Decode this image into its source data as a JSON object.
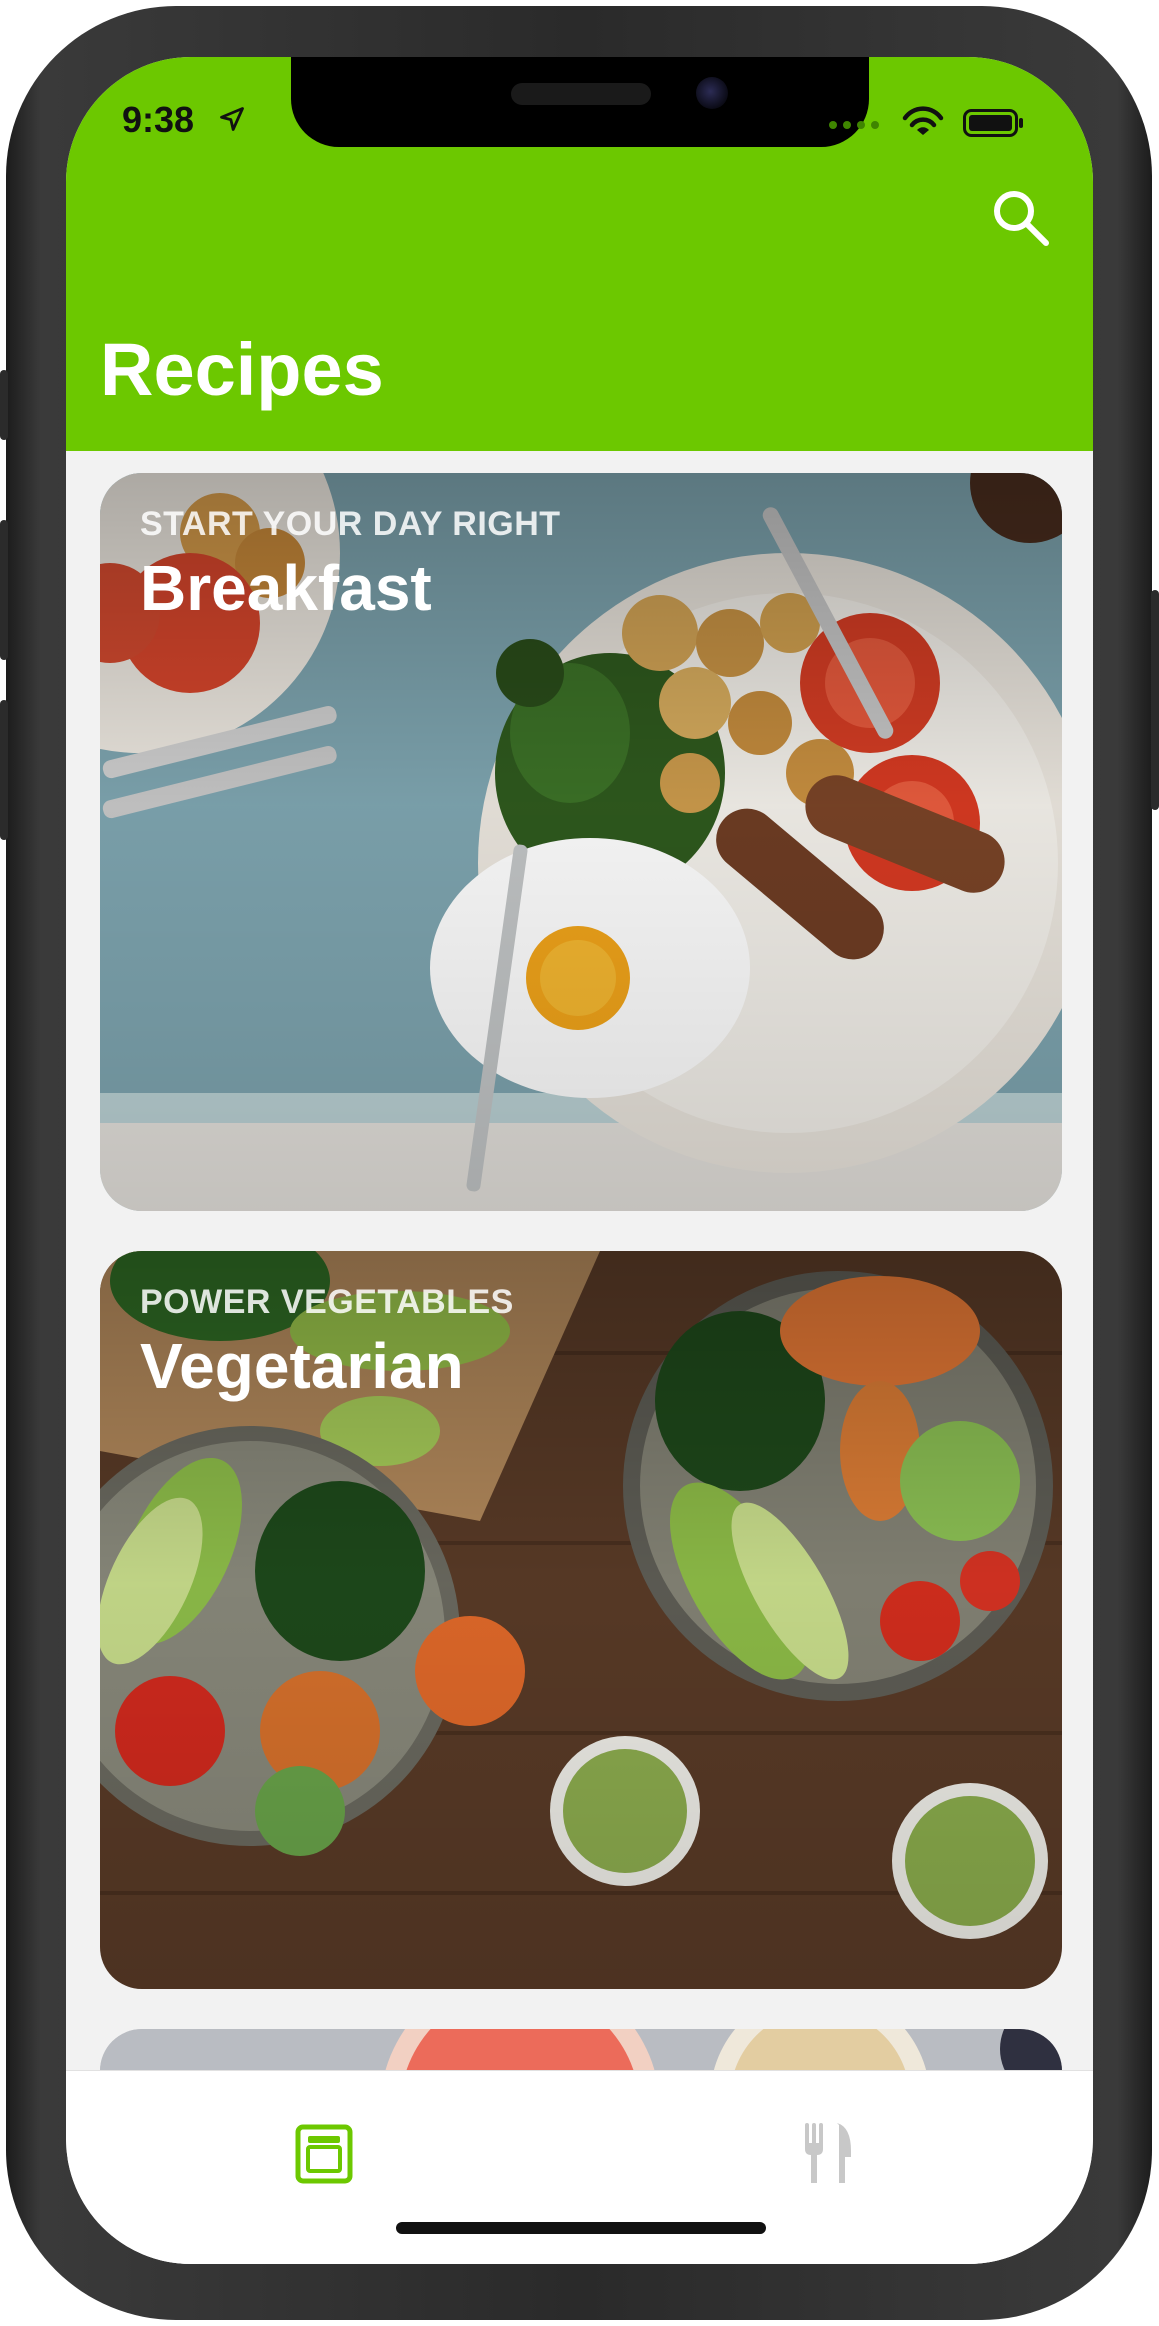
{
  "status_bar": {
    "time": "9:38"
  },
  "nav": {
    "title": "Recipes"
  },
  "icons": {
    "search": "search-icon",
    "location": "location-arrow-icon",
    "signal": "signal-dots-icon",
    "wifi": "wifi-icon",
    "battery": "battery-icon",
    "tab_recipes": "recipes-tab-icon",
    "tab_utensils": "fork-knife-icon"
  },
  "colors": {
    "accent": "#6cc800",
    "tab_active": "#6cc800",
    "tab_inactive": "#c8c8c8"
  },
  "categories": [
    {
      "subtitle": "START YOUR DAY RIGHT",
      "title": "Breakfast"
    },
    {
      "subtitle": "POWER VEGETABLES",
      "title": "Vegetarian"
    }
  ],
  "tabs": [
    {
      "icon": "recipes-tab-icon",
      "active": true
    },
    {
      "icon": "fork-knife-icon",
      "active": false
    }
  ]
}
